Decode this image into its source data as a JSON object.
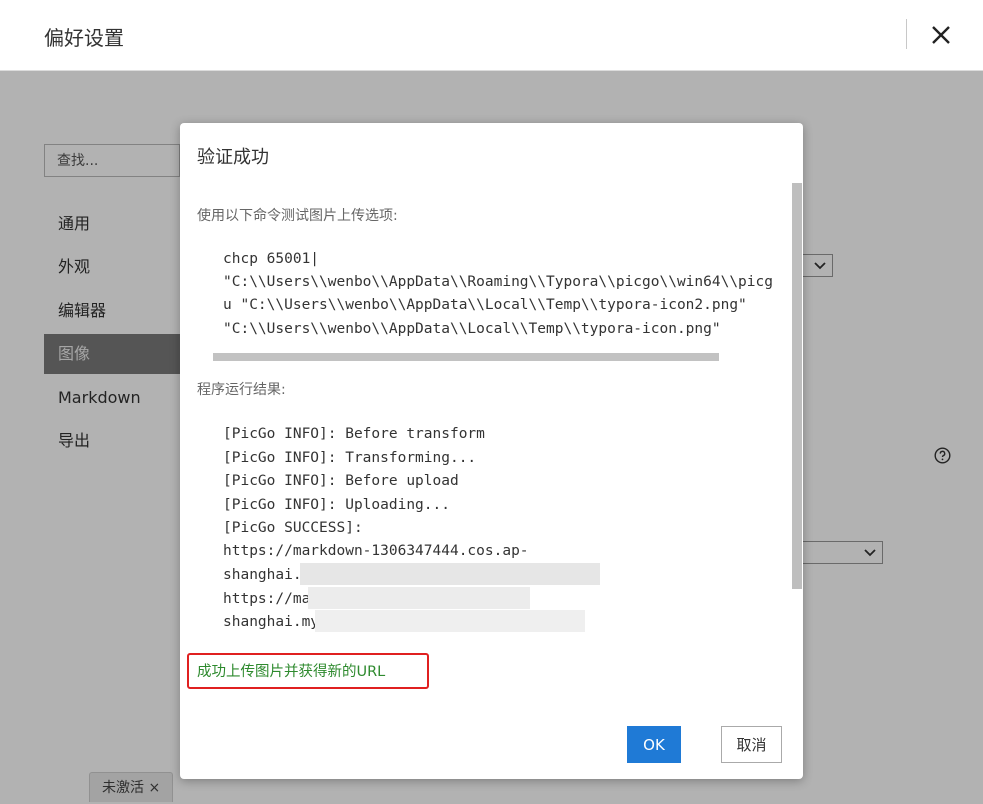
{
  "window": {
    "title": "偏好设置",
    "close_icon": "close-icon"
  },
  "sidebar": {
    "search_placeholder": "查找...",
    "items": [
      {
        "label": "通用"
      },
      {
        "label": "外观"
      },
      {
        "label": "编辑器"
      },
      {
        "label": "图像",
        "active": true
      },
      {
        "label": "Markdown"
      },
      {
        "label": "导出"
      }
    ]
  },
  "status_bar": {
    "label": "未激活 ×"
  },
  "dialog": {
    "title": "验证成功",
    "command_label": "使用以下命令测试图片上传选项:",
    "command_lines": [
      "chcp 65001|",
      "\"C:\\\\Users\\\\wenbo\\\\AppData\\\\Roaming\\\\Typora\\\\picgo\\\\win64\\\\picg",
      "u \"C:\\\\Users\\\\wenbo\\\\AppData\\\\Local\\\\Temp\\\\typora-icon2.png\"",
      "\"C:\\\\Users\\\\wenbo\\\\AppData\\\\Local\\\\Temp\\\\typora-icon.png\""
    ],
    "result_label": "程序运行结果:",
    "result_lines": [
      "[PicGo INFO]: Before transform",
      "[PicGo INFO]: Transforming...",
      "[PicGo INFO]: Before upload",
      "[PicGo INFO]: Uploading...",
      "[PicGo SUCCESS]:",
      "https://markdown-1306347444.cos.ap-",
      "shanghai.",
      "https://ma",
      "shanghai.my"
    ],
    "success_message": "成功上传图片并获得新的URL",
    "ok_label": "OK",
    "cancel_label": "取消"
  },
  "colors": {
    "ok_button": "#1f7ad6",
    "success_text": "#2e8a2e",
    "highlight_border": "#e02020",
    "active_nav": "#7a7a7a"
  }
}
